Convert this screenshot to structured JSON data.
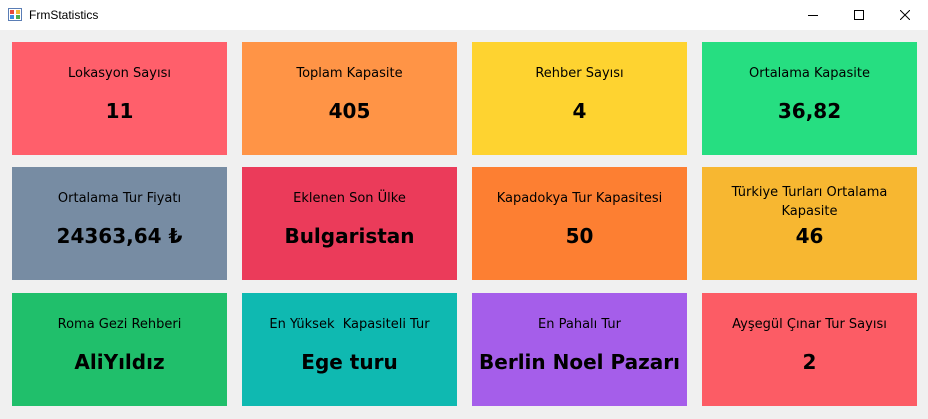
{
  "window": {
    "title": "FrmStatistics",
    "controls": {
      "minimize": "─",
      "maximize": "☐",
      "close": "✕"
    },
    "icon": "windows-form-icon"
  },
  "tiles": [
    {
      "label": "Lokasyon Sayısı",
      "value": "11",
      "color": "#ff5f6b"
    },
    {
      "label": "Toplam Kapasite",
      "value": "405",
      "color": "#ff9446"
    },
    {
      "label": "Rehber Sayısı",
      "value": "4",
      "color": "#fed330"
    },
    {
      "label": "Ortalama Kapasite",
      "value": "36,82",
      "color": "#26de81"
    },
    {
      "label": "Ortalama Tur Fiyatı",
      "value": "24363,64 ₺",
      "color": "#778ca3"
    },
    {
      "label": "Eklenen Son Ülke",
      "value": "Bulgaristan",
      "color": "#eb3b5a"
    },
    {
      "label": "Kapadokya Tur Kapasitesi",
      "value": "50",
      "color": "#fd7f32"
    },
    {
      "label": "Türkiye Turları Ortalama Kapasite",
      "value": "46",
      "color": "#f7b731"
    },
    {
      "label": "Roma Gezi Rehberi",
      "value": "AliYıldız",
      "color": "#20bf6b"
    },
    {
      "label": "En Yüksek  Kapasiteli Tur",
      "value": "Ege turu",
      "color": "#0fb9b1"
    },
    {
      "label": "En Pahalı Tur",
      "value": "Berlin Noel Pazarı",
      "color": "#a55eea"
    },
    {
      "label": "Ayşegül Çınar Tur Sayısı",
      "value": "2",
      "color": "#fc5c65"
    }
  ]
}
